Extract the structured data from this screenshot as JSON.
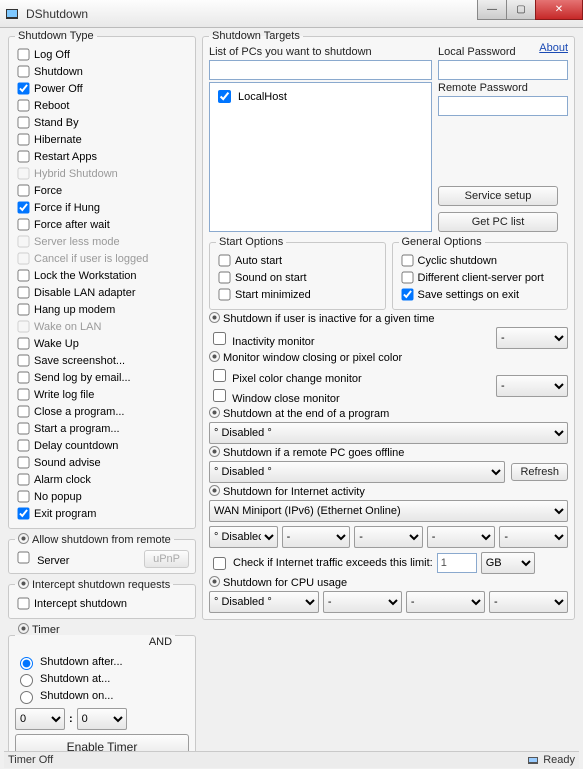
{
  "window": {
    "title": "DShutdown",
    "min": "—",
    "max": "▢",
    "close": "✕"
  },
  "about": "About",
  "shutdown_type": {
    "legend": "Shutdown Type",
    "items": [
      {
        "label": "Log Off",
        "checked": false,
        "disabled": false
      },
      {
        "label": "Shutdown",
        "checked": false,
        "disabled": false
      },
      {
        "label": "Power Off",
        "checked": true,
        "disabled": false
      },
      {
        "label": "Reboot",
        "checked": false,
        "disabled": false
      },
      {
        "label": "Stand By",
        "checked": false,
        "disabled": false
      },
      {
        "label": "Hibernate",
        "checked": false,
        "disabled": false
      },
      {
        "label": "Restart Apps",
        "checked": false,
        "disabled": false
      },
      {
        "label": "Hybrid Shutdown",
        "checked": false,
        "disabled": true
      },
      {
        "label": "Force",
        "checked": false,
        "disabled": false
      },
      {
        "label": "Force if Hung",
        "checked": true,
        "disabled": false
      },
      {
        "label": "Force after wait",
        "checked": false,
        "disabled": false
      },
      {
        "label": "Server less mode",
        "checked": false,
        "disabled": true
      },
      {
        "label": "Cancel if user is logged",
        "checked": false,
        "disabled": true
      },
      {
        "label": "Lock the Workstation",
        "checked": false,
        "disabled": false
      },
      {
        "label": "Disable LAN adapter",
        "checked": false,
        "disabled": false
      },
      {
        "label": "Hang up modem",
        "checked": false,
        "disabled": false
      },
      {
        "label": "Wake on LAN",
        "checked": false,
        "disabled": true
      },
      {
        "label": "Wake Up",
        "checked": false,
        "disabled": false
      },
      {
        "label": "Save screenshot...",
        "checked": false,
        "disabled": false
      },
      {
        "label": "Send log by email...",
        "checked": false,
        "disabled": false
      },
      {
        "label": "Write log file",
        "checked": false,
        "disabled": false
      },
      {
        "label": "Close a program...",
        "checked": false,
        "disabled": false
      },
      {
        "label": "Start a program...",
        "checked": false,
        "disabled": false
      },
      {
        "label": "Delay countdown",
        "checked": false,
        "disabled": false
      },
      {
        "label": "Sound advise",
        "checked": false,
        "disabled": false
      },
      {
        "label": "Alarm clock",
        "checked": false,
        "disabled": false
      },
      {
        "label": "No popup",
        "checked": false,
        "disabled": false
      },
      {
        "label": "Exit program",
        "checked": true,
        "disabled": false
      }
    ]
  },
  "allow_remote": {
    "legend": "Allow shutdown from remote",
    "server_label": "Server",
    "upnp_label": "uPnP"
  },
  "intercept": {
    "legend": "Intercept shutdown requests",
    "label": "Intercept shutdown"
  },
  "timer": {
    "legend": "Timer",
    "and": "AND",
    "options": [
      "Shutdown after...",
      "Shutdown at...",
      "Shutdown on..."
    ],
    "selected": 0,
    "h": "0",
    "m": "0",
    "sep": ":",
    "button": "Enable Timer"
  },
  "targets": {
    "legend": "Shutdown Targets",
    "list_label": "List of PCs you want to shutdown",
    "input_value": "",
    "localhost": "LocalHost",
    "local_pw_label": "Local Password",
    "remote_pw_label": "Remote Password",
    "service_btn": "Service setup",
    "getlist_btn": "Get PC list"
  },
  "start_options": {
    "legend": "Start Options",
    "items": [
      "Auto start",
      "Sound on start",
      "Start minimized"
    ]
  },
  "general_options": {
    "legend": "General Options",
    "items": [
      {
        "label": "Cyclic shutdown",
        "checked": false
      },
      {
        "label": "Different client-server port",
        "checked": false
      },
      {
        "label": "Save settings on exit",
        "checked": true
      }
    ]
  },
  "cond_inactive": {
    "title": "Shutdown if user is inactive for a given time",
    "cb": "Inactivity monitor",
    "dd": "-"
  },
  "cond_pixel": {
    "title": "Monitor window closing or pixel color",
    "cb1": "Pixel color change monitor",
    "cb2": "Window close monitor",
    "dd": "-"
  },
  "cond_endprog": {
    "title": "Shutdown at the end of a program",
    "dd": "° Disabled °"
  },
  "cond_remote_offline": {
    "title": "Shutdown if a remote PC goes offline",
    "dd": "° Disabled °",
    "refresh": "Refresh"
  },
  "cond_internet": {
    "title": "Shutdown for Internet activity",
    "adapter": "WAN Miniport (IPv6) (Ethernet Online)",
    "d1": "° Disablec",
    "d2": "-",
    "d3": "-",
    "d4": "-",
    "d5": "-",
    "limit_label": "Check if Internet traffic exceeds this limit:",
    "limit_val": "1",
    "limit_unit": "GB"
  },
  "cond_cpu": {
    "title": "Shutdown for CPU usage",
    "d1": "° Disabled °",
    "d2": "-",
    "d3": "-",
    "d4": "-"
  },
  "status": {
    "left": "Timer Off",
    "right": "Ready"
  }
}
